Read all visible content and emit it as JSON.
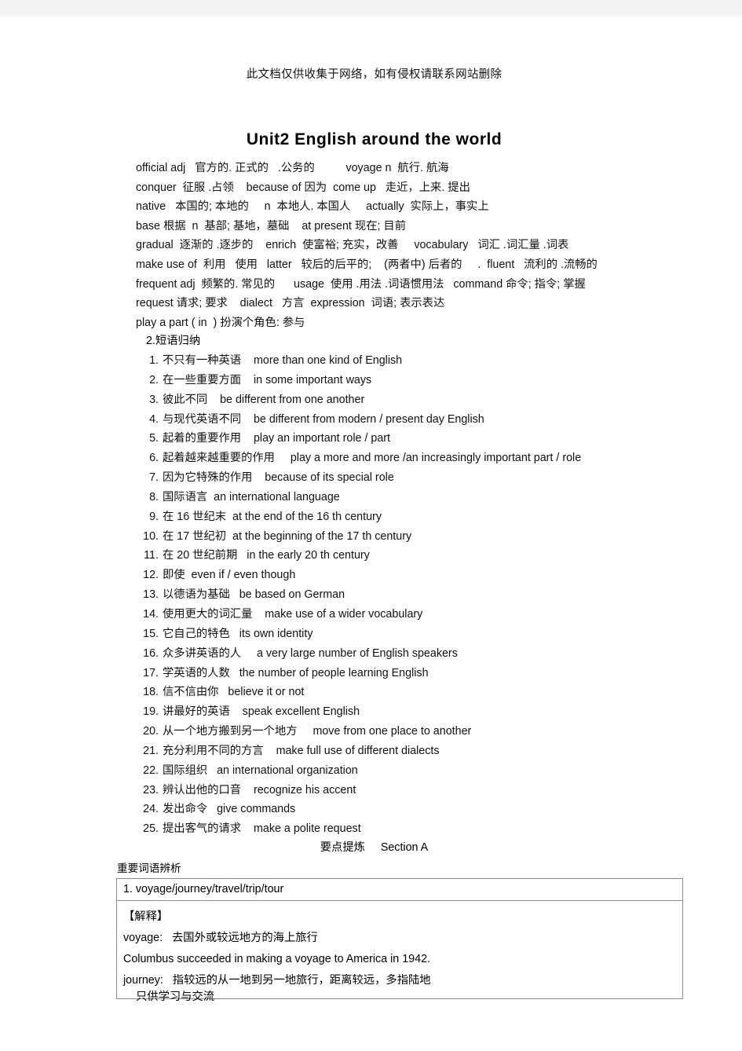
{
  "document": {
    "watermark_top": "此文档仅供收集于网络，如有侵权请联系网站删除",
    "title": "Unit2 English around the world",
    "watermark_bottom": "只供学习与交流",
    "centered_note": "要点提炼     Section A",
    "section_label": "2.短语归纳",
    "table_caption": "重要词语辨析"
  },
  "vocabulary_lines": [
    "official adj   官方的. 正式的   .公务的          voyage n  航行. 航海",
    "conquer  征服 .占领    because of 因为  come up   走近，上来. 提出",
    "native   本国的; 本地的     n  本地人. 本国人     actually  实际上，事实上",
    "base 根据  n  基部; 基地，墓础    at present 现在; 目前",
    "gradual  逐渐的 .逐步的    enrich  使富裕; 充实，改善     vocabulary   词汇 .词汇量 .词表",
    "make use of  利用   使用   latter   较后的后平的;    (两者中) 后者的     .  fluent   流利的 .流畅的",
    "frequent adj  频繁的. 常见的      usage  使用 .用法 .词语惯用法   command 命令; 指令; 掌握",
    "request 请求; 要求    dialect   方言  expression  词语; 表示表达",
    "play a part ( in  ) 扮演个角色: 参与"
  ],
  "phrases": [
    {
      "num": "1.",
      "cn": "不只有一种英语",
      "en": "more than one kind of English"
    },
    {
      "num": "2.",
      "cn": "在一些重要方面",
      "en": "in some important ways"
    },
    {
      "num": "3.",
      "cn": "彼此不同",
      "en": "be different from one another"
    },
    {
      "num": "4.",
      "cn": "与现代英语不同",
      "en": "be different from modern / present day English"
    },
    {
      "num": "5.",
      "cn": "起着的重要作用",
      "en": "play an important role / part"
    },
    {
      "num": "6.",
      "cn": "起着越来越重要的作用",
      "en": "play a more and more /an increasingly important part / role"
    },
    {
      "num": "7.",
      "cn": "因为它特殊的作用",
      "en": "because of its special role"
    },
    {
      "num": "8.",
      "cn": "国际语言",
      "en": "an international language"
    },
    {
      "num": "9.",
      "cn": "在 16 世纪末",
      "en": "at the end of the 16 th century"
    },
    {
      "num": "10.",
      "cn": "在 17 世纪初",
      "en": "at the beginning of the 17 th century"
    },
    {
      "num": "11.",
      "cn": "在 20 世纪前期",
      "en": "in the early 20 th century"
    },
    {
      "num": "12.",
      "cn": "即使",
      "en": "even if / even though"
    },
    {
      "num": "13.",
      "cn": "以德语为基础",
      "en": "be based on German"
    },
    {
      "num": "14.",
      "cn": "使用更大的词汇量",
      "en": "make use of a wider vocabulary"
    },
    {
      "num": "15.",
      "cn": "它自己的特色",
      "en": "its own identity"
    },
    {
      "num": "16.",
      "cn": "众多讲英语的人",
      "en": "a very large number of English speakers"
    },
    {
      "num": "17.",
      "cn": "学英语的人数",
      "en": "the number of people learning English"
    },
    {
      "num": "18.",
      "cn": "信不信由你",
      "en": "believe it or not"
    },
    {
      "num": "19.",
      "cn": "讲最好的英语",
      "en": "speak excellent English"
    },
    {
      "num": "20.",
      "cn": "从一个地方搬到另一个地方",
      "en": "move from one place to another"
    },
    {
      "num": "21.",
      "cn": "充分利用不同的方言",
      "en": "make full use of different dialects"
    },
    {
      "num": "22.",
      "cn": "国际组织",
      "en": "an international organization"
    },
    {
      "num": "23.",
      "cn": "辨认出他的口音",
      "en": "recognize his accent"
    },
    {
      "num": "24.",
      "cn": "发出命令",
      "en": "give commands"
    },
    {
      "num": "25.",
      "cn": "提出客气的请求",
      "en": "make a polite request"
    }
  ],
  "term_table": {
    "header": "1. voyage/journey/travel/trip/tour",
    "body_lines": [
      "【解释】",
      "voyage:   去国外或较远地方的海上旅行",
      "Columbus succeeded in making a voyage to America in 1942.",
      "journey:   指较远的从一地到另一地旅行，距离较远，多指陆地"
    ]
  }
}
